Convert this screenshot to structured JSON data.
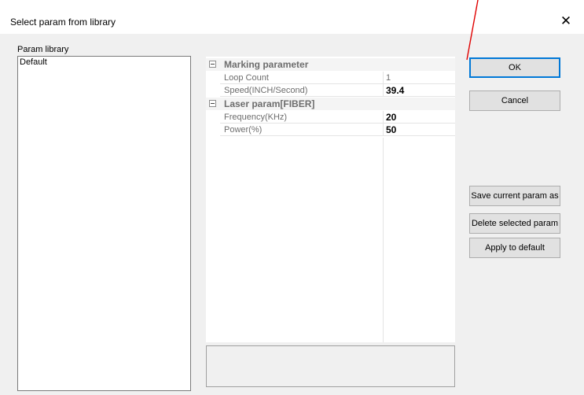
{
  "window": {
    "title": "Select param from library",
    "close_glyph": "✕"
  },
  "library": {
    "label": "Param library",
    "items": [
      "Default"
    ]
  },
  "property_grid": {
    "categories": [
      {
        "name": "Marking parameter",
        "properties": [
          {
            "name": "Loop Count",
            "value": "1",
            "bold": false
          },
          {
            "name": "Speed(INCH/Second)",
            "value": "39.4",
            "bold": true
          }
        ]
      },
      {
        "name": "Laser param[FIBER]",
        "properties": [
          {
            "name": "Frequency(KHz)",
            "value": "20",
            "bold": true
          },
          {
            "name": "Power(%)",
            "value": "50",
            "bold": true
          }
        ]
      }
    ]
  },
  "buttons": {
    "ok": "OK",
    "cancel": "Cancel",
    "save_current": "Save current param as",
    "delete_selected": "Delete selected param",
    "apply_default": "Apply to default"
  },
  "colors": {
    "accent": "#0078d7",
    "annotation_line": "#e00000"
  },
  "icons": {
    "close": "close-icon",
    "collapse": "minus-box-icon"
  }
}
